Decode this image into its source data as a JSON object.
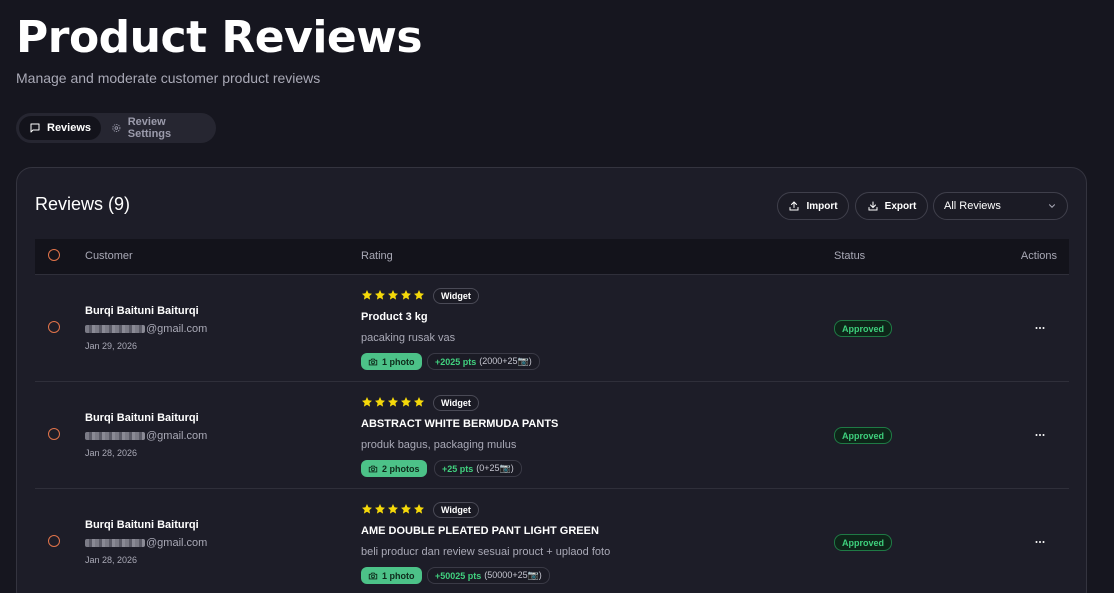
{
  "header": {
    "title": "Product Reviews",
    "subtitle": "Manage and moderate customer product reviews"
  },
  "tabs": [
    {
      "label": "Reviews",
      "icon": "message-square-icon",
      "active": true
    },
    {
      "label": "Review Settings",
      "icon": "gear-icon",
      "active": false
    }
  ],
  "card": {
    "title": "Reviews (9)",
    "import_label": "Import",
    "export_label": "Export",
    "filter_value": "All Reviews"
  },
  "table": {
    "columns": {
      "customer": "Customer",
      "rating": "Rating",
      "status": "Status",
      "actions": "Actions"
    },
    "rows": [
      {
        "name": "Burqi Baituni Baiturqi",
        "email_domain": "@gmail.com",
        "date": "Jan 29, 2026",
        "rating": 5,
        "source": "Widget",
        "product": "Product 3 kg",
        "review": "pacaking rusak vas",
        "photos": "1 photo",
        "points": "+2025 pts",
        "points_detail": "(2000+25📷)",
        "status": "Approved"
      },
      {
        "name": "Burqi Baituni Baiturqi",
        "email_domain": "@gmail.com",
        "date": "Jan 28, 2026",
        "rating": 5,
        "source": "Widget",
        "product": "ABSTRACT WHITE BERMUDA PANTS",
        "review": "produk bagus, packaging mulus",
        "photos": "2 photos",
        "points": "+25 pts",
        "points_detail": "(0+25📷)",
        "status": "Approved"
      },
      {
        "name": "Burqi Baituni Baiturqi",
        "email_domain": "@gmail.com",
        "date": "Jan 28, 2026",
        "rating": 5,
        "source": "Widget",
        "product": "AME DOUBLE PLEATED PANT LIGHT GREEN",
        "review": "beli producr dan review sesuai prouct + uplaod foto",
        "photos": "1 photo",
        "points": "+50025 pts",
        "points_detail": "(50000+25📷)",
        "status": "Approved"
      }
    ]
  },
  "colors": {
    "background": "#16161f",
    "star": "#f5d90a",
    "approved": "#3ecf7c",
    "photo_badge": "#4cc288",
    "radio": "#e0734a"
  }
}
